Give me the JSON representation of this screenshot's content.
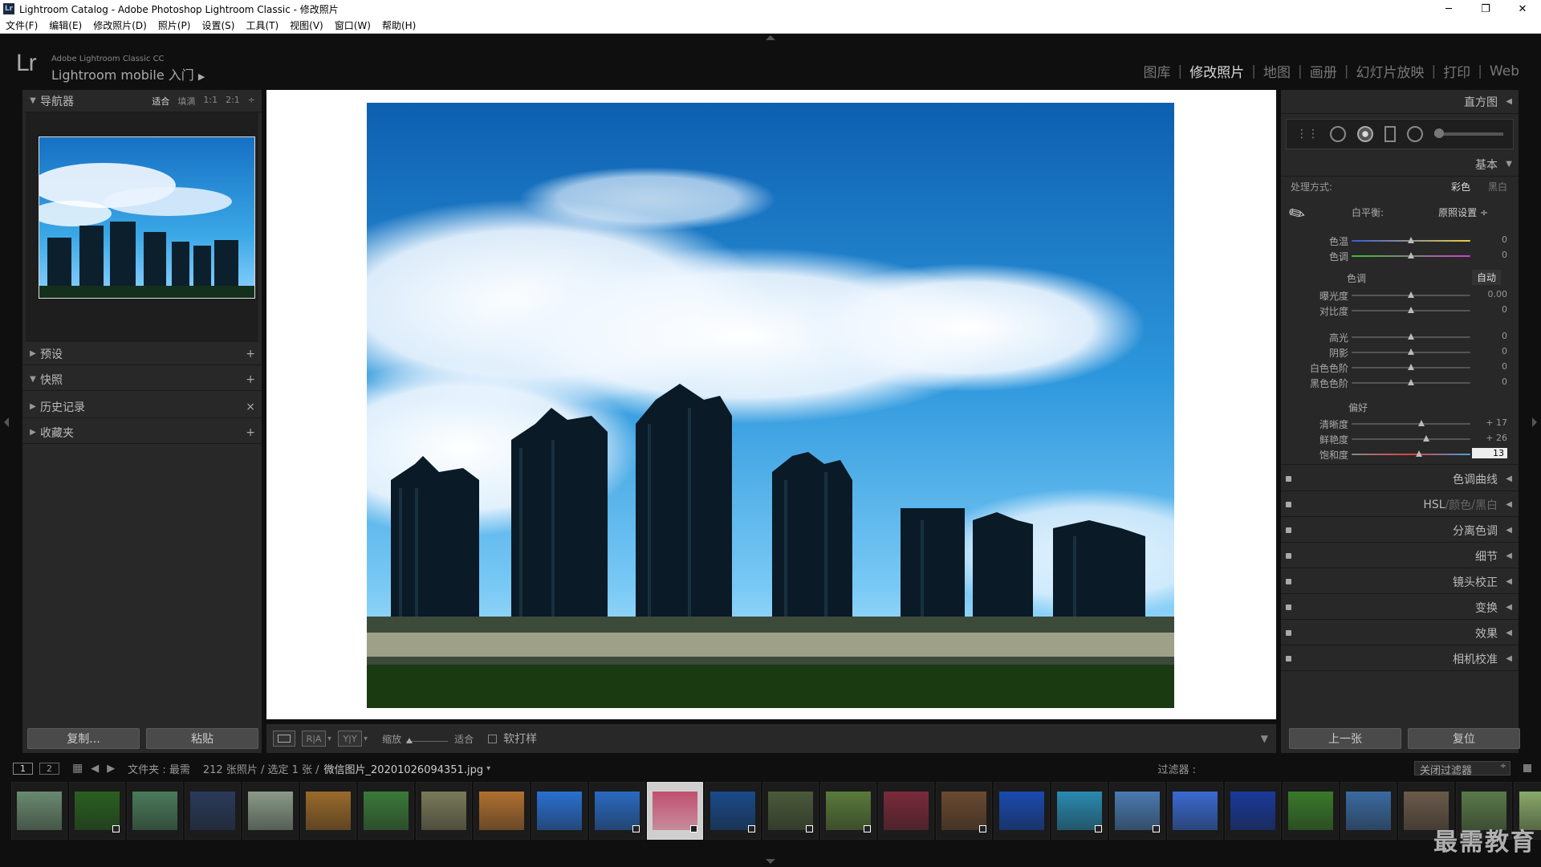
{
  "window": {
    "title": "Lightroom Catalog - Adobe Photoshop Lightroom Classic - 修改照片",
    "app_icon": "Lr"
  },
  "menu": [
    "文件(F)",
    "编辑(E)",
    "修改照片(D)",
    "照片(P)",
    "设置(S)",
    "工具(T)",
    "视图(V)",
    "窗口(W)",
    "帮助(H)"
  ],
  "identity": {
    "logo": "Lr",
    "product": "Adobe Lightroom Classic CC",
    "mobile": "Lightroom mobile 入门",
    "arrow": "▶"
  },
  "modules": [
    "图库",
    "修改照片",
    "地图",
    "画册",
    "幻灯片放映",
    "打印",
    "Web"
  ],
  "active_module": "修改照片",
  "left": {
    "navigator": {
      "title": "导航器",
      "zooms": [
        "适合",
        "填满",
        "1:1",
        "2:1"
      ],
      "active_zoom": "适合"
    },
    "sections": [
      {
        "title": "预设",
        "tri": "▶",
        "action": "+"
      },
      {
        "title": "快照",
        "tri": "▼",
        "action": "+"
      },
      {
        "title": "历史记录",
        "tri": "▶",
        "action": "×"
      },
      {
        "title": "收藏夹",
        "tri": "▶",
        "action": "+"
      }
    ],
    "copy": "复制...",
    "paste": "粘贴"
  },
  "toolbar": {
    "zoom_label": "缩放",
    "zoom_value": "适合",
    "softproof": "软打样",
    "before_after": "R|A",
    "yy": "Y|Y"
  },
  "right": {
    "histogram": "直方图",
    "basic": "基本",
    "treatment_label": "处理方式:",
    "treatment_color": "彩色",
    "treatment_bw": "黑白",
    "wb_label": "白平衡:",
    "wb_value": "原照设置 ÷",
    "tone_label": "色调",
    "auto": "自动",
    "presence": "偏好",
    "sliders_wb": [
      {
        "label": "色温",
        "value": "0",
        "pos": 0.5
      },
      {
        "label": "色调",
        "value": "0",
        "pos": 0.5
      }
    ],
    "sliders_tone": [
      {
        "label": "曝光度",
        "value": "0.00",
        "pos": 0.5
      },
      {
        "label": "对比度",
        "value": "0",
        "pos": 0.5
      }
    ],
    "sliders_tone2": [
      {
        "label": "高光",
        "value": "0",
        "pos": 0.5
      },
      {
        "label": "阴影",
        "value": "0",
        "pos": 0.5
      },
      {
        "label": "白色色阶",
        "value": "0",
        "pos": 0.5
      },
      {
        "label": "黑色色阶",
        "value": "0",
        "pos": 0.5
      }
    ],
    "sliders_presence": [
      {
        "label": "清晰度",
        "value": "+ 17",
        "pos": 0.585
      },
      {
        "label": "鲜艳度",
        "value": "+ 26",
        "pos": 0.63
      },
      {
        "label": "饱和度",
        "value": "13",
        "pos": 0.565
      }
    ],
    "panels": [
      "色调曲线",
      "HSL",
      "分离色调",
      "细节",
      "镜头校正",
      "变换",
      "效果",
      "相机校准"
    ],
    "hsl_extra": [
      "颜色",
      "黑白"
    ],
    "prev": "上一张",
    "reset": "复位"
  },
  "filmbar": {
    "page1": "1",
    "page2": "2",
    "source": "文件夹 : 最需",
    "count": "212 张照片 / 选定 1 张 /",
    "filename": "微信图片_20201026094351.jpg",
    "filter_label": "过滤器 :",
    "filter_value": "关闭过滤器"
  },
  "watermark": "最需教育"
}
